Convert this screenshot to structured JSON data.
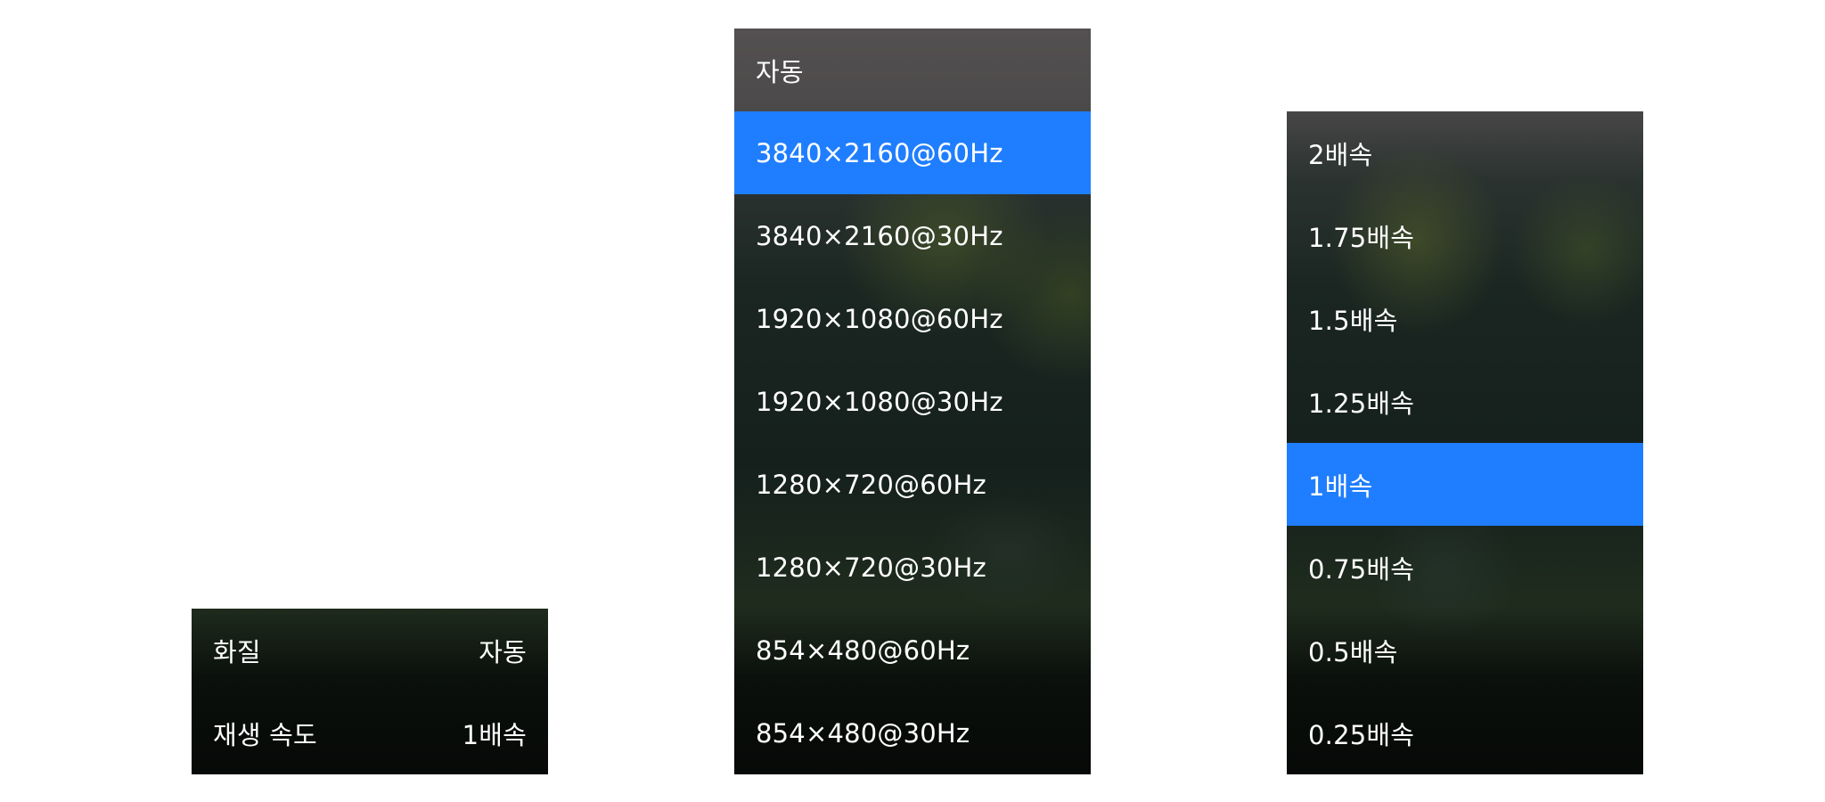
{
  "settings_menu": {
    "rows": [
      {
        "label": "화질",
        "value": "자동"
      },
      {
        "label": "재생 속도",
        "value": "1배속"
      }
    ]
  },
  "quality_menu": {
    "selected_index": 1,
    "options": [
      "자동",
      "3840×2160@60Hz",
      "3840×2160@30Hz",
      "1920×1080@60Hz",
      "1920×1080@30Hz",
      "1280×720@60Hz",
      "1280×720@30Hz",
      "854×480@60Hz",
      "854×480@30Hz"
    ]
  },
  "speed_menu": {
    "selected_index": 4,
    "options": [
      "2배속",
      "1.75배속",
      "1.5배속",
      "1.25배속",
      "1배속",
      "0.75배속",
      "0.5배속",
      "0.25배속"
    ]
  },
  "colors": {
    "selected_background": "#1f7eff",
    "text": "#ffffff"
  }
}
